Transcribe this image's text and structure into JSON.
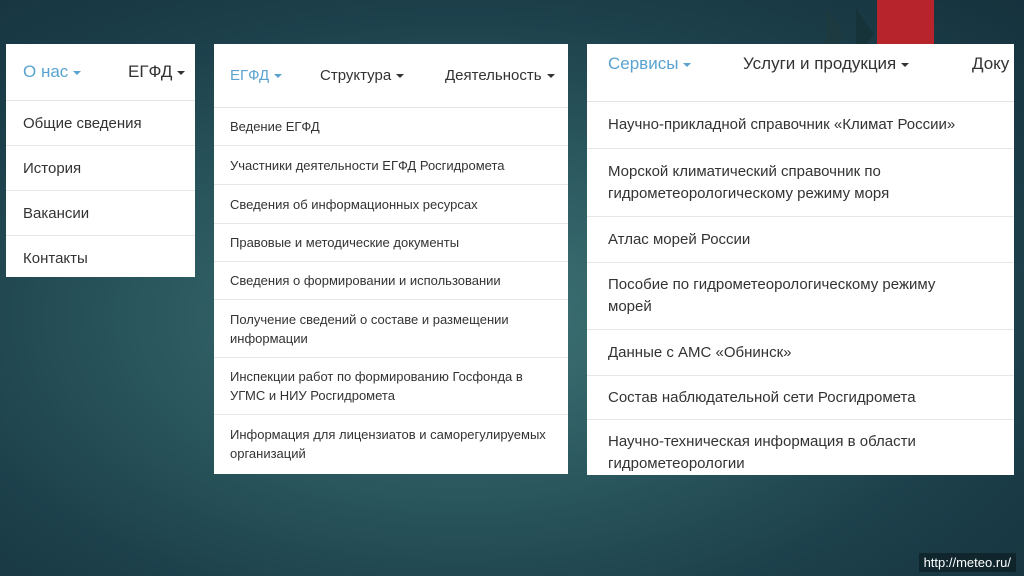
{
  "panel1": {
    "nav": [
      {
        "label": "О нас",
        "caret": true,
        "active": true
      },
      {
        "label": "ЕГФД",
        "caret": true,
        "active": false
      }
    ],
    "items": [
      "Общие сведения",
      "История",
      "Вакансии",
      "Контакты"
    ]
  },
  "panel2": {
    "nav": [
      {
        "label": "ЕГФД",
        "caret": true,
        "active": true
      },
      {
        "label": "Структура",
        "caret": true,
        "active": false
      },
      {
        "label": "Деятельность",
        "caret": true,
        "active": false
      }
    ],
    "items": [
      [
        "Ведение ЕГФД"
      ],
      [
        "Участники деятельности ЕГФД Росгидромета"
      ],
      [
        "Сведения об информационных ресурсах"
      ],
      [
        "Правовые и методические документы"
      ],
      [
        "Сведения о формировании и использовании"
      ],
      [
        "Получение сведений о составе и размещении",
        "информации"
      ],
      [
        "Инспекции работ по формированию Госфонда в",
        "УГМС и НИУ Росгидромета"
      ],
      [
        "Информация для лицензиатов и саморегулируемых",
        "организаций"
      ]
    ]
  },
  "panel3": {
    "nav": [
      {
        "label": "Сервисы",
        "caret": true,
        "active": true
      },
      {
        "label": "Услуги и продукция",
        "caret": true,
        "active": false
      },
      {
        "label": "Доку",
        "caret": false,
        "active": false
      }
    ],
    "items": [
      [
        "Научно-прикладной справочник «Климат России»"
      ],
      [
        "Морской климатический справочник по",
        "гидрометеорологическому режиму моря"
      ],
      [
        "Атлас морей России"
      ],
      [
        "Пособие по гидрометеорологическому режиму",
        "морей"
      ],
      [
        "Данные с АМС «Обнинск»"
      ],
      [
        "Состав наблюдательной сети Росгидромета"
      ],
      [
        "Научно-техническая информация в области",
        "гидрометеорологии"
      ]
    ]
  },
  "footer": {
    "url": "http://meteo.ru/"
  },
  "colors": {
    "active": "#5aa3d0",
    "accent_red": "#b8242b"
  }
}
